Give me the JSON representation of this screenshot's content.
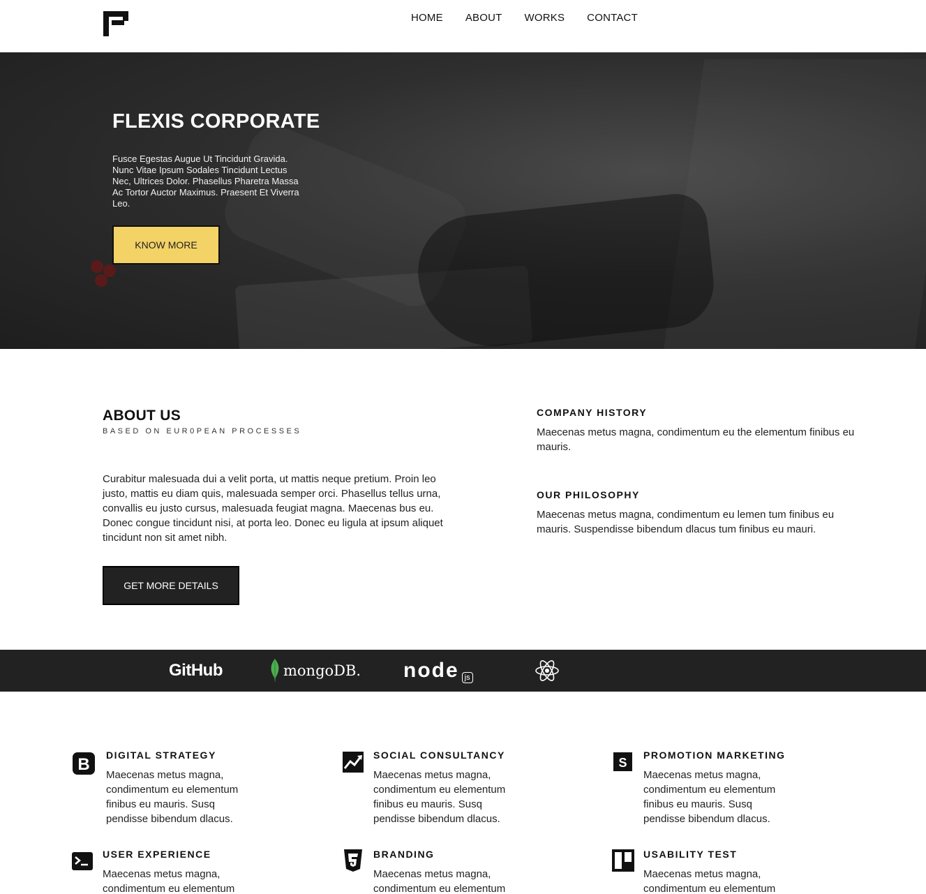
{
  "header": {
    "logo_icon": "flexis-f-logo-icon",
    "nav": [
      {
        "label": "HOME"
      },
      {
        "label": "ABOUT"
      },
      {
        "label": "WORKS"
      },
      {
        "label": "CONTACT"
      }
    ]
  },
  "hero": {
    "title": "FLEXIS CORPORATE",
    "text": "Fusce Egestas Augue Ut Tincidunt Gravida. Nunc Vitae Ipsum Sodales Tincidunt Lectus Nec, Ultrices Dolor. Phasellus Pharetra Massa Ac Tortor Auctor Maximus. Praesent Et Viverra Leo.",
    "button_label": "KNOW MORE",
    "button_color": "#f3d266"
  },
  "about": {
    "title": "ABOUT US",
    "subtitle": "BASED ON EUR0PEAN PROCESSES",
    "text": "Curabitur malesuada dui a velit porta, ut mattis neque pretium. Proin leo justo, mattis eu diam quis, malesuada semper orci. Phasellus tellus urna, convallis eu justo cursus, malesuada feugiat magna. Maecenas bus eu. Donec congue tincidunt nisi, at porta leo. Donec eu ligula at ipsum aliquet tincidunt non sit amet nibh.",
    "button_label": "GET MORE DETAILS",
    "history_title": "COMPANY HISTORY",
    "history_text": "Maecenas metus magna, condimentum eu the elementum finibus eu mauris.",
    "philosophy_title": "OUR PHILOSOPHY",
    "philosophy_text": "Maecenas metus magna, condimentum eu lemen tum finibus eu mauris. Suspendisse bibendum dlacus tum finibus eu mauri."
  },
  "brands": {
    "github": "GitHub",
    "mongodb": "mongoDB.",
    "node": "node",
    "node_badge": "js",
    "react_icon": "react-atom-icon",
    "strip_color": "#222222"
  },
  "services": [
    {
      "icon": "bootstrap-b-icon",
      "title": "DIGITAL STRATEGY",
      "text": "Maecenas metus magna, condimentum eu elementum finibus eu mauris. Susq pendisse bibendum dlacus."
    },
    {
      "icon": "line-chart-icon",
      "title": "SOCIAL CONSULTANCY",
      "text": "Maecenas metus magna, condimentum eu elementum finibus eu mauris. Susq pendisse bibendum dlacus."
    },
    {
      "icon": "s-square-icon",
      "title": "PROMOTION MARKETING",
      "text": "Maecenas metus magna, condimentum eu elementum finibus eu mauris. Susq pendisse bibendum dlacus."
    },
    {
      "icon": "terminal-icon",
      "title": "USER EXPERIENCE",
      "text": "Maecenas metus magna, condimentum eu elementum"
    },
    {
      "icon": "css3-shield-icon",
      "title": "BRANDING",
      "text": "Maecenas metus magna, condimentum eu elementum"
    },
    {
      "icon": "trello-board-icon",
      "title": "USABILITY TEST",
      "text": "Maecenas metus magna, condimentum eu elementum"
    }
  ]
}
